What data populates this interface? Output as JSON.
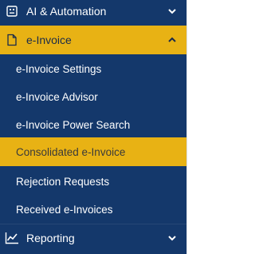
{
  "sidebar": {
    "sections": [
      {
        "label": "AI & Automation",
        "icon": "robot-icon",
        "state": "collapsed"
      },
      {
        "label": "e-Invoice",
        "icon": "document-icon",
        "state": "expanded"
      },
      {
        "label": "Reporting",
        "icon": "chart-line-icon",
        "state": "collapsed"
      }
    ],
    "einvoice_items": [
      {
        "label": "e-Invoice Settings"
      },
      {
        "label": "e-Invoice Advisor"
      },
      {
        "label": "e-Invoice Power Search"
      },
      {
        "label": "Consolidated e-Invoice",
        "active": true
      },
      {
        "label": "Rejection Requests"
      },
      {
        "label": "Received e-Invoices"
      }
    ]
  },
  "colors": {
    "sidebar_bg": "#14386b",
    "accent": "#e8b214",
    "text": "#ffffff"
  }
}
